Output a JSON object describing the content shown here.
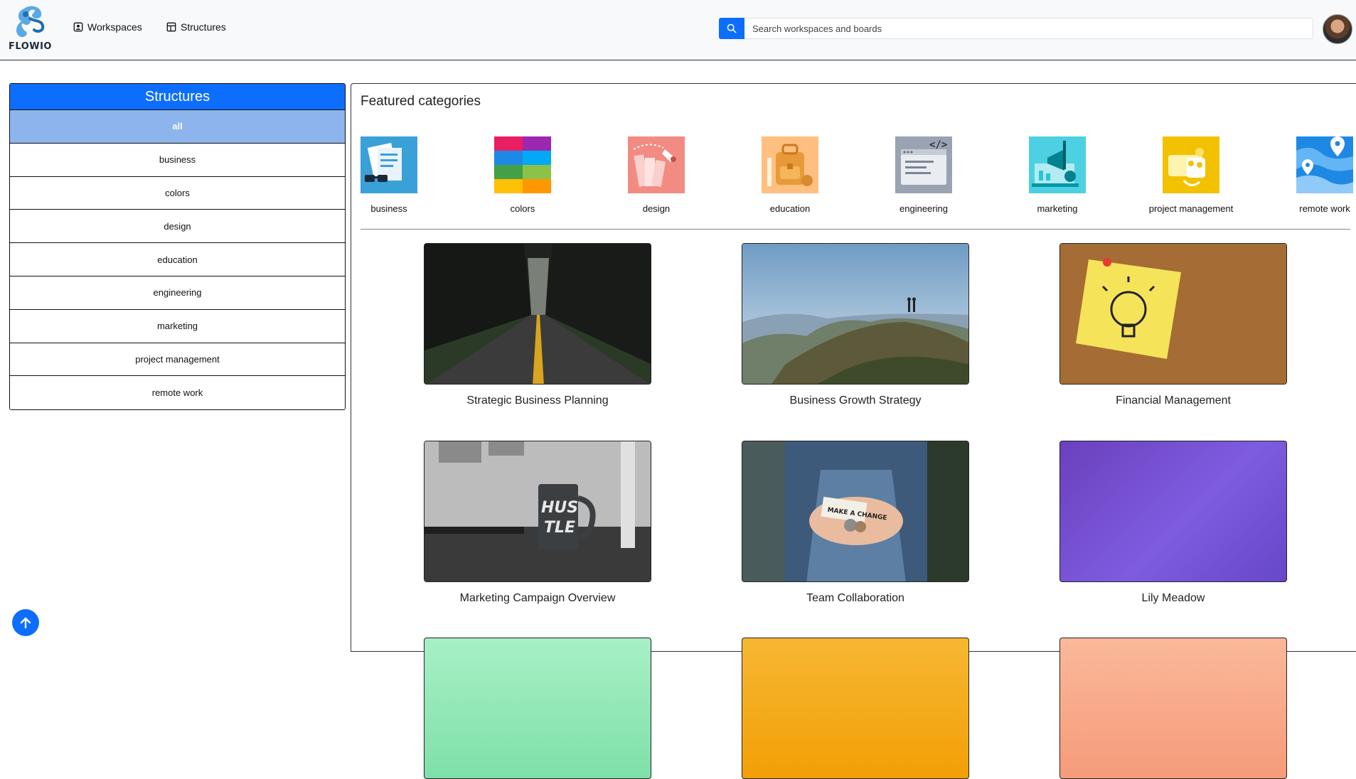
{
  "header": {
    "logo_text": "FLOWIO",
    "nav": [
      {
        "label": "Workspaces",
        "icon": "person-badge-icon"
      },
      {
        "label": "Structures",
        "icon": "layout-icon"
      }
    ],
    "search": {
      "placeholder": "Search workspaces and boards",
      "value": ""
    },
    "accent_color": "#0d6efd"
  },
  "sidebar": {
    "title": "Structures",
    "items": [
      {
        "label": "all",
        "active": true
      },
      {
        "label": "business"
      },
      {
        "label": "colors"
      },
      {
        "label": "design"
      },
      {
        "label": "education"
      },
      {
        "label": "engineering"
      },
      {
        "label": "marketing"
      },
      {
        "label": "project management"
      },
      {
        "label": "remote work"
      }
    ]
  },
  "main": {
    "featured_title": "Featured categories",
    "categories": [
      {
        "label": "business",
        "icon": "documents-glasses-icon",
        "color": "#3aa0d8"
      },
      {
        "label": "colors",
        "icon": "color-grid-icon",
        "color": "#e91e63"
      },
      {
        "label": "design",
        "icon": "palette-swatch-icon",
        "color": "#f28b82"
      },
      {
        "label": "education",
        "icon": "backpack-icon",
        "color": "#ffbf80"
      },
      {
        "label": "engineering",
        "icon": "code-window-icon",
        "color": "#9aa3b2"
      },
      {
        "label": "marketing",
        "icon": "megaphone-laptop-icon",
        "color": "#4dd0e1"
      },
      {
        "label": "project management",
        "icon": "team-board-icon",
        "color": "#f2c200"
      },
      {
        "label": "remote work",
        "icon": "map-pins-icon",
        "color": "#1e88e5"
      }
    ],
    "cards": [
      {
        "title": "Strategic Business Planning",
        "image": "forest-road-photo"
      },
      {
        "title": "Business Growth Strategy",
        "image": "mountain-hikers-photo"
      },
      {
        "title": "Financial Management",
        "image": "lightbulb-sticky-note-photo"
      },
      {
        "title": "Marketing Campaign Overview",
        "image": "hustle-mug-photo"
      },
      {
        "title": "Team Collaboration",
        "image": "hands-coins-photo"
      },
      {
        "title": "Lily Meadow",
        "image": "purple-gradient"
      }
    ]
  }
}
